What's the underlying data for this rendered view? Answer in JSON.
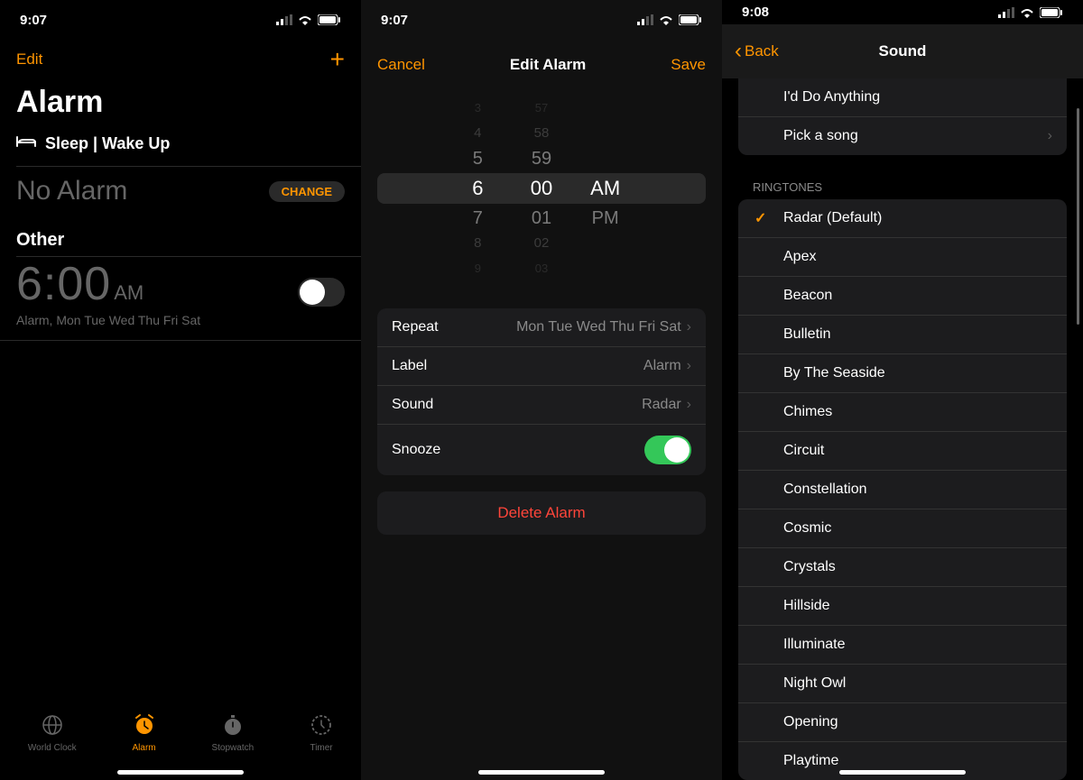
{
  "screen1": {
    "status_time": "9:07",
    "nav_edit": "Edit",
    "title": "Alarm",
    "sleep_label": "Sleep | Wake Up",
    "no_alarm": "No Alarm",
    "change": "CHANGE",
    "other": "Other",
    "alarm_hour": "6:00",
    "alarm_ampm": "AM",
    "alarm_sub": "Alarm, Mon Tue Wed Thu Fri Sat",
    "tabs": {
      "world_clock": "World Clock",
      "alarm": "Alarm",
      "stopwatch": "Stopwatch",
      "timer": "Timer"
    }
  },
  "screen2": {
    "status_time": "9:07",
    "cancel": "Cancel",
    "title": "Edit Alarm",
    "save": "Save",
    "picker": {
      "r_3": {
        "h": "3",
        "m": "57",
        "p": ""
      },
      "r_2": {
        "h": "4",
        "m": "58",
        "p": ""
      },
      "r_1": {
        "h": "5",
        "m": "59",
        "p": ""
      },
      "sel": {
        "h": "6",
        "m": "00",
        "p": "AM"
      },
      "r1": {
        "h": "7",
        "m": "01",
        "p": "PM"
      },
      "r2": {
        "h": "8",
        "m": "02",
        "p": ""
      },
      "r3": {
        "h": "9",
        "m": "03",
        "p": ""
      }
    },
    "rows": {
      "repeat_label": "Repeat",
      "repeat_value": "Mon Tue Wed Thu Fri Sat",
      "label_label": "Label",
      "label_value": "Alarm",
      "sound_label": "Sound",
      "sound_value": "Radar",
      "snooze_label": "Snooze"
    },
    "delete": "Delete Alarm"
  },
  "screen3": {
    "status_time": "9:08",
    "back": "Back",
    "title": "Sound",
    "songs": [
      "I'd Do Anything",
      "Pick a song"
    ],
    "ringtones_header": "RINGTONES",
    "ringtones": [
      "Radar (Default)",
      "Apex",
      "Beacon",
      "Bulletin",
      "By The Seaside",
      "Chimes",
      "Circuit",
      "Constellation",
      "Cosmic",
      "Crystals",
      "Hillside",
      "Illuminate",
      "Night Owl",
      "Opening",
      "Playtime"
    ]
  }
}
